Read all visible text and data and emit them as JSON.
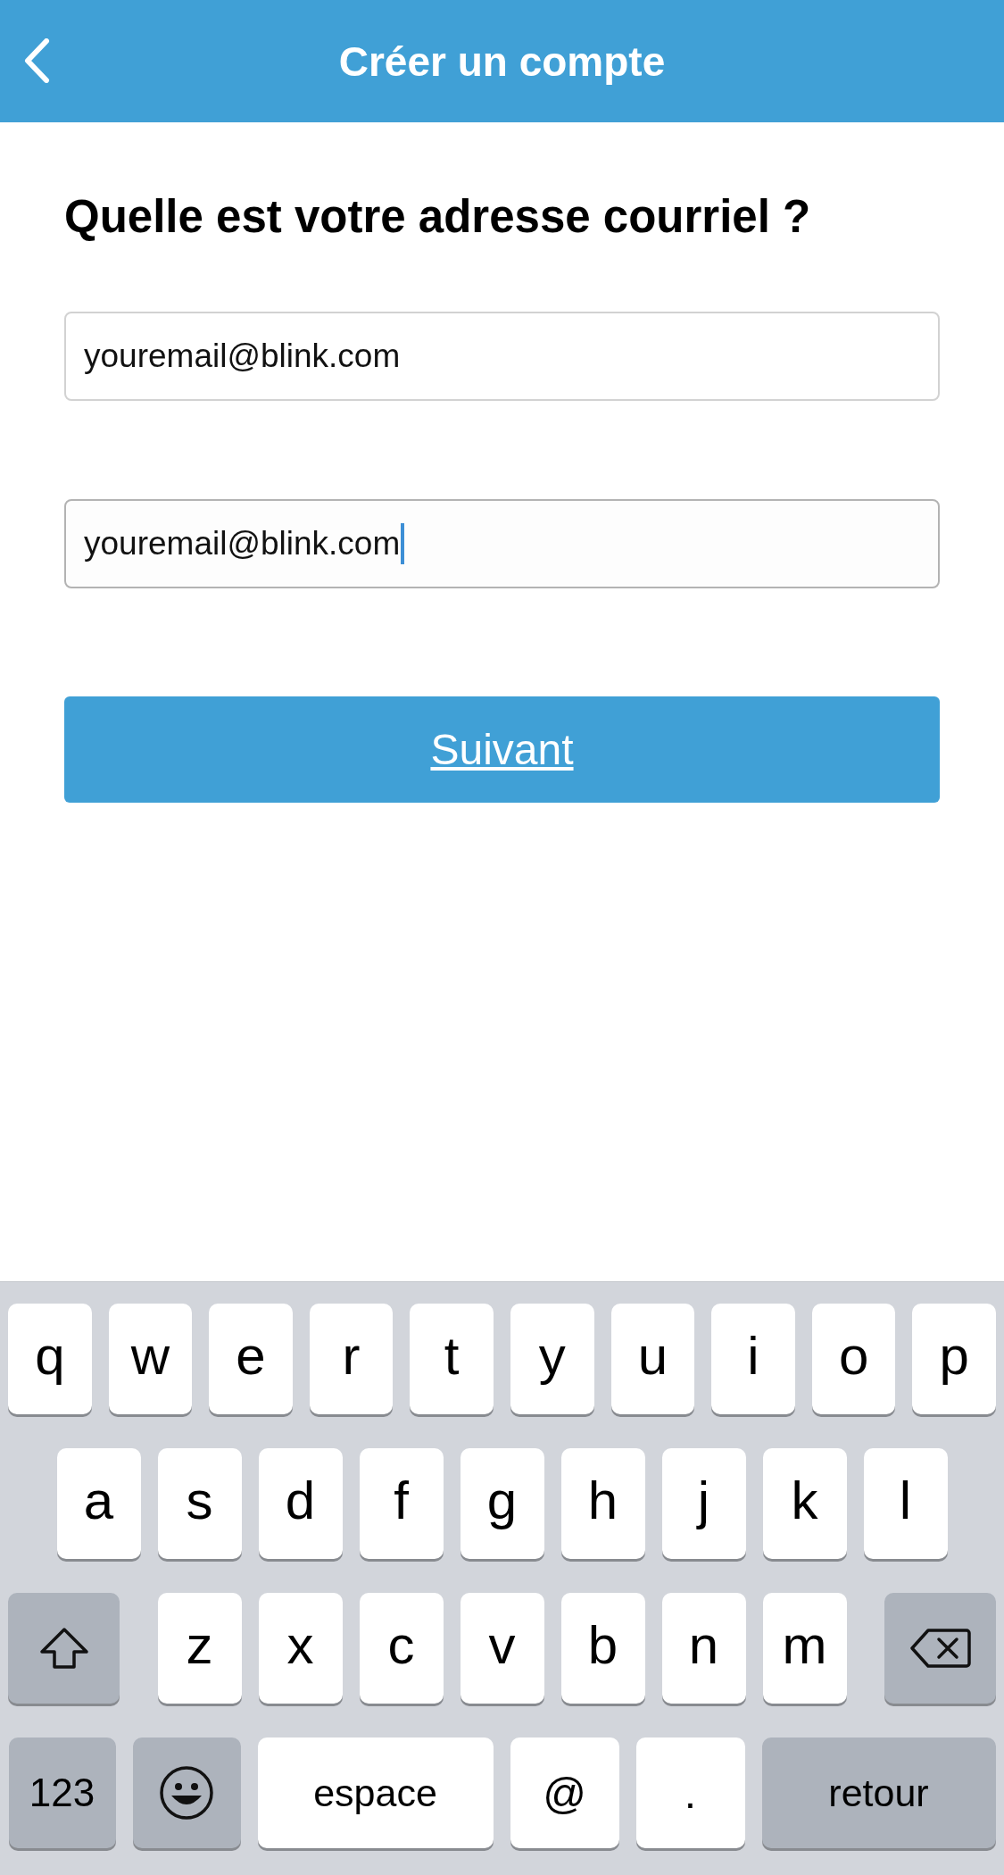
{
  "header": {
    "title": "Créer un compte"
  },
  "question": "Quelle est votre adresse courriel ?",
  "fields": [
    {
      "value": "youremail@blink.com",
      "focused": false
    },
    {
      "value": "youremail@blink.com",
      "focused": true
    }
  ],
  "next_button": "Suivant",
  "keyboard": {
    "top_row": [
      {
        "kind": "letter",
        "label": "q"
      },
      {
        "kind": "letter",
        "label": "w"
      },
      {
        "kind": "letter",
        "label": "e"
      },
      {
        "kind": "letter",
        "label": "r"
      },
      {
        "kind": "letter",
        "label": "t"
      },
      {
        "kind": "letter",
        "label": "y"
      },
      {
        "kind": "letter",
        "label": "u"
      },
      {
        "kind": "letter",
        "label": "i"
      },
      {
        "kind": "letter",
        "label": "o"
      },
      {
        "kind": "letter",
        "label": "p"
      }
    ],
    "middle_row": [
      {
        "kind": "letter",
        "label": "a"
      },
      {
        "kind": "letter",
        "label": "s"
      },
      {
        "kind": "letter",
        "label": "d"
      },
      {
        "kind": "letter",
        "label": "f"
      },
      {
        "kind": "letter",
        "label": "g"
      },
      {
        "kind": "letter",
        "label": "h"
      },
      {
        "kind": "letter",
        "label": "j"
      },
      {
        "kind": "letter",
        "label": "k"
      },
      {
        "kind": "letter",
        "label": "l"
      }
    ],
    "lower_row": [
      {
        "kind": "shift"
      },
      {
        "kind": "letter",
        "label": "z"
      },
      {
        "kind": "letter",
        "label": "x"
      },
      {
        "kind": "letter",
        "label": "c"
      },
      {
        "kind": "letter",
        "label": "v"
      },
      {
        "kind": "letter",
        "label": "b"
      },
      {
        "kind": "letter",
        "label": "n"
      },
      {
        "kind": "letter",
        "label": "m"
      },
      {
        "kind": "delete"
      }
    ],
    "bottom_row": [
      {
        "kind": "mode",
        "label": "123"
      },
      {
        "kind": "emoji"
      },
      {
        "kind": "space",
        "label": "espace"
      },
      {
        "kind": "char",
        "label": "@"
      },
      {
        "kind": "char",
        "label": "."
      },
      {
        "kind": "return",
        "label": "retour"
      }
    ]
  }
}
